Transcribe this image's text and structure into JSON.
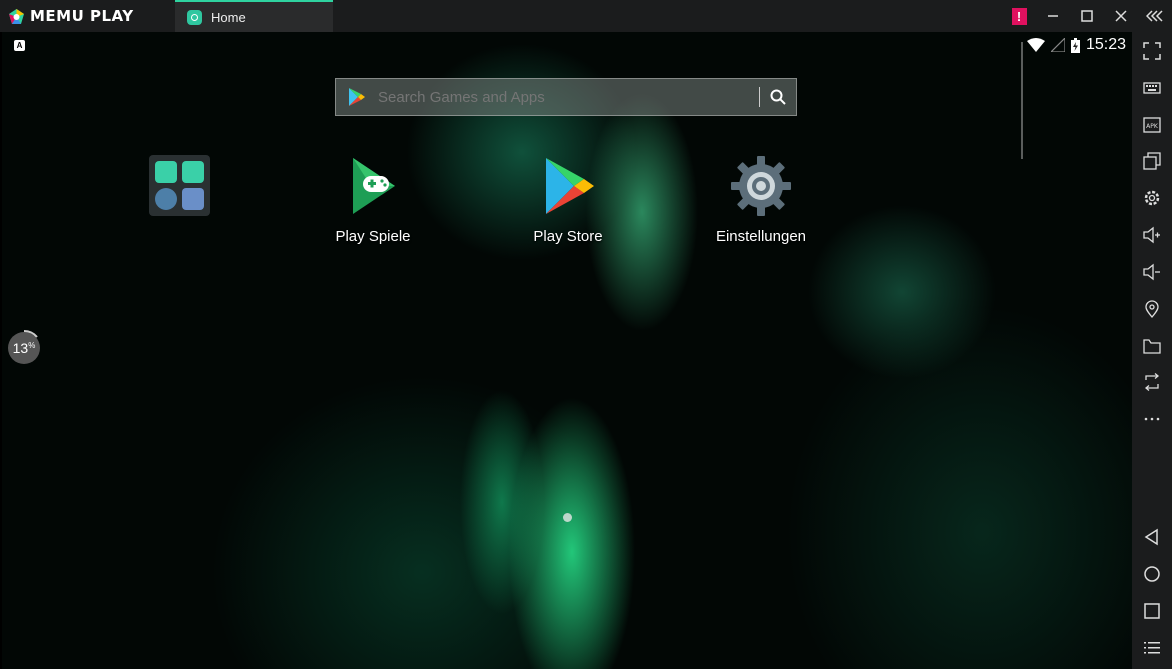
{
  "window": {
    "logo_text": "MEMU PLAY",
    "tab_label": "Home",
    "notification_badge": "!",
    "buttons": [
      "minimize",
      "maximize",
      "close",
      "collapse-sidebar"
    ]
  },
  "statusbar": {
    "left_indicator": "A",
    "time": "15:23"
  },
  "search": {
    "placeholder": "Search Games and Apps"
  },
  "apps": [
    {
      "label": "Play Spiele",
      "icon": "play-games-icon"
    },
    {
      "label": "Play Store",
      "icon": "play-store-icon"
    },
    {
      "label": "Einstellungen",
      "icon": "settings-gear-icon"
    }
  ],
  "progress": {
    "value": "13",
    "unit": "%"
  },
  "sidebar_tools": [
    "fullscreen",
    "keyboard-mapping",
    "apk-install",
    "multi-window",
    "settings",
    "volume-up",
    "volume-down",
    "location",
    "shared-folder",
    "rotate",
    "more",
    "back",
    "home",
    "recent-apps",
    "menu"
  ],
  "colors": {
    "accent": "#2fd3a0",
    "titlebar": "#1b1c1d",
    "badge": "#e0115f"
  }
}
